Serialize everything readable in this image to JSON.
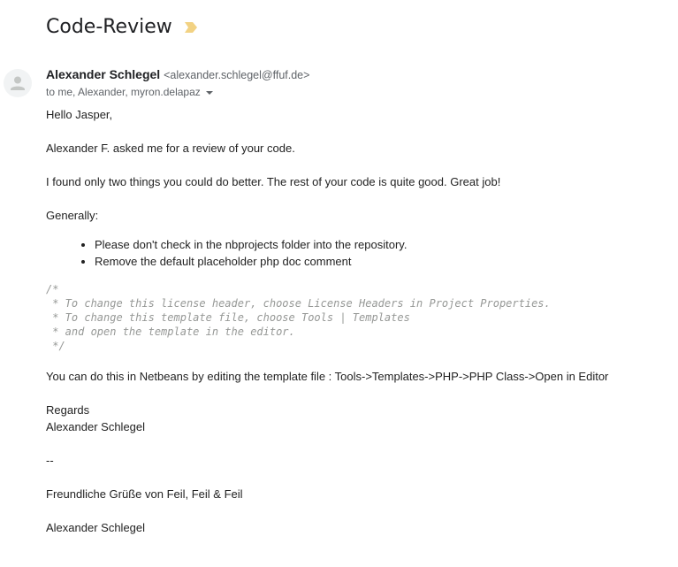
{
  "email": {
    "subject": "Code-Review",
    "importance_icon": "importance-marker-icon",
    "sender": {
      "name": "Alexander Schlegel",
      "email": "<alexander.schlegel@ffuf.de>",
      "avatar_icon": "person-avatar-icon"
    },
    "recipients": "to me, Alexander, myron.delapaz",
    "body": {
      "greeting": "Hello Jasper,",
      "p1": "Alexander F. asked me for a review of your code.",
      "p2": "I found only two things you could do better. The rest of your code is quite good. Great job!",
      "p3": "Generally:",
      "bullets": [
        "Please don't check in the nbprojects folder into the repository.",
        "Remove the default placeholder php doc comment"
      ],
      "code_lines": [
        "/*",
        " * To change this license header, choose License Headers in Project Properties.",
        " * To change this template file, choose Tools | Templates",
        " * and open the template in the editor.",
        " */"
      ],
      "p4": "You can do this in Netbeans by editing the template file : Tools->Templates->PHP->PHP Class->Open in Editor",
      "regards": "Regards",
      "regards_name": "Alexander Schlegel",
      "sig_sep": "--",
      "sig_greeting": "Freundliche Grüße von Feil, Feil & Feil",
      "sig_name": "Alexander Schlegel"
    }
  },
  "colors": {
    "importance": "#f2d283",
    "code_comment": "#969896",
    "secondary_text": "#5f6368"
  }
}
